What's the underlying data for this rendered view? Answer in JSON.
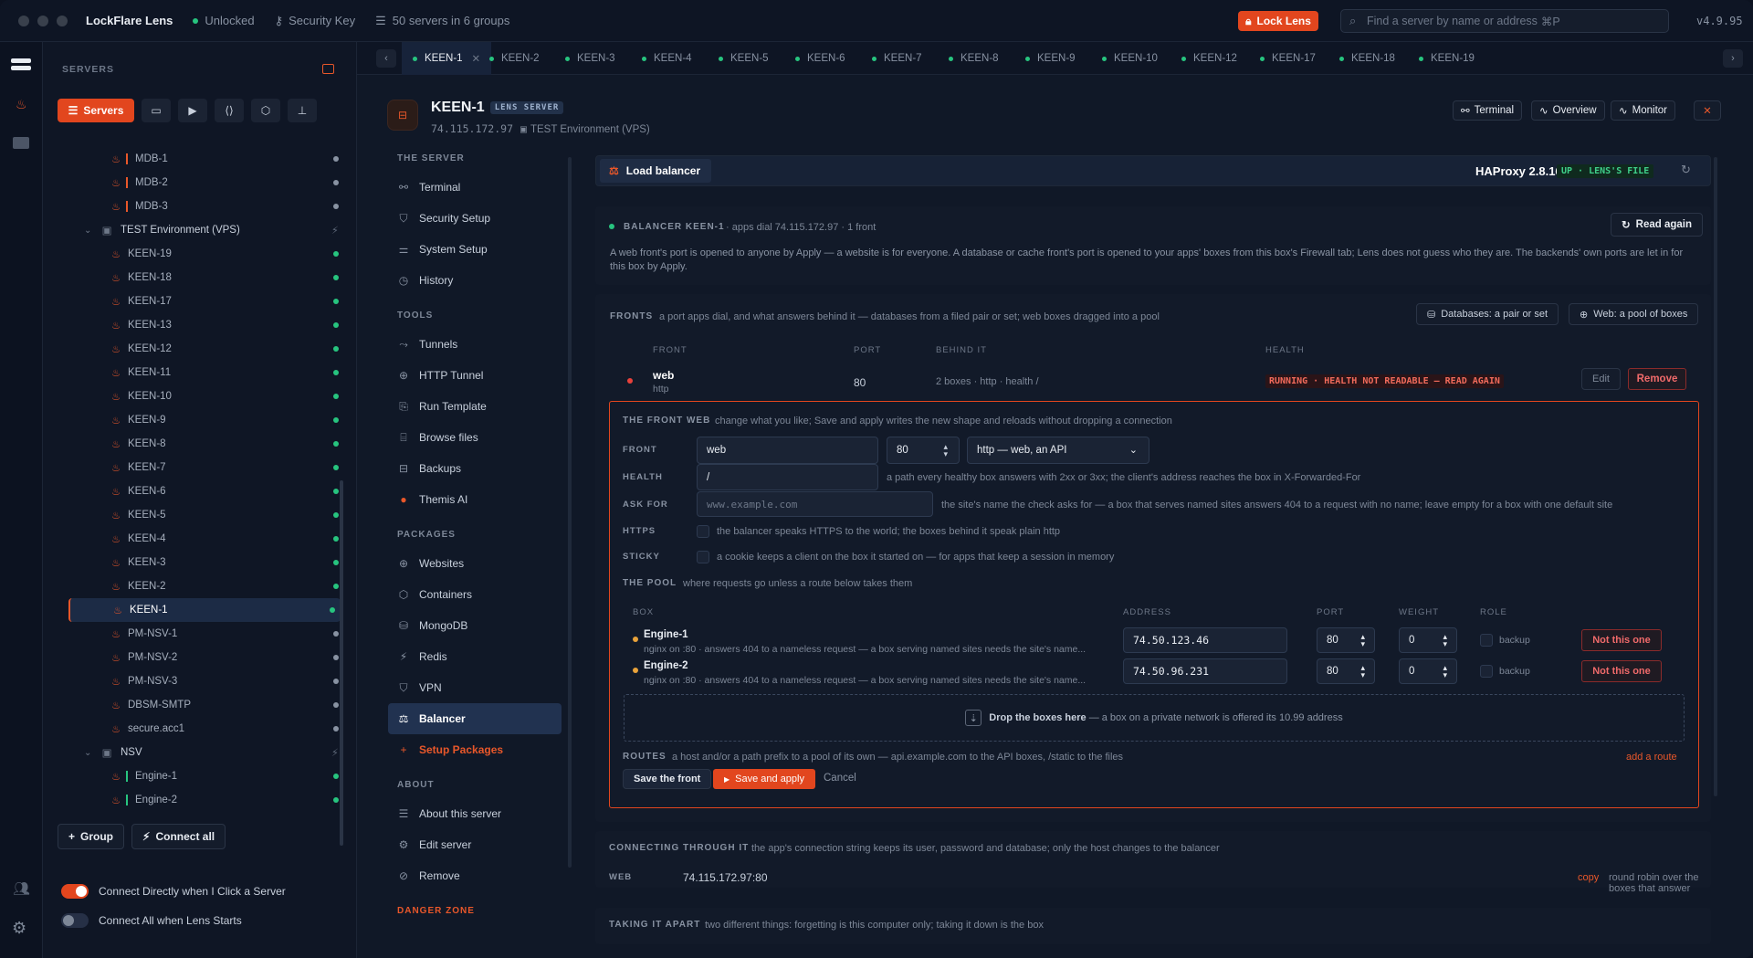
{
  "app": {
    "name": "LockFlare Lens",
    "status": "Unlocked",
    "security_key": "Security Key",
    "servers_summary": "50 servers in 6 groups",
    "lock_label": "Lock Lens",
    "search_placeholder": "Find a server by name or address",
    "search_shortcut": "⌘P",
    "version": "v4.9.95"
  },
  "sidebar": {
    "title": "SERVERS",
    "servers_btn": "Servers",
    "group_btn": "Group",
    "connect_all_btn": "Connect all",
    "toggle1_label": "Connect Directly when I Click a Server",
    "toggle2_label": "Connect All when Lens Starts",
    "tree": [
      {
        "kind": "server",
        "name": "MDB-1",
        "bar": "#e8572a",
        "status": "#8892a2"
      },
      {
        "kind": "server",
        "name": "MDB-2",
        "bar": "#e8572a",
        "status": "#8892a2"
      },
      {
        "kind": "server",
        "name": "MDB-3",
        "bar": "#e8572a",
        "status": "#8892a2"
      },
      {
        "kind": "group",
        "name": "TEST Environment (VPS)"
      },
      {
        "kind": "server",
        "name": "KEEN-19",
        "status": "#27c47f"
      },
      {
        "kind": "server",
        "name": "KEEN-18",
        "status": "#27c47f"
      },
      {
        "kind": "server",
        "name": "KEEN-17",
        "status": "#27c47f"
      },
      {
        "kind": "server",
        "name": "KEEN-13",
        "status": "#27c47f"
      },
      {
        "kind": "server",
        "name": "KEEN-12",
        "status": "#27c47f"
      },
      {
        "kind": "server",
        "name": "KEEN-11",
        "status": "#27c47f"
      },
      {
        "kind": "server",
        "name": "KEEN-10",
        "status": "#27c47f"
      },
      {
        "kind": "server",
        "name": "KEEN-9",
        "status": "#27c47f"
      },
      {
        "kind": "server",
        "name": "KEEN-8",
        "status": "#27c47f"
      },
      {
        "kind": "server",
        "name": "KEEN-7",
        "status": "#27c47f"
      },
      {
        "kind": "server",
        "name": "KEEN-6",
        "status": "#27c47f"
      },
      {
        "kind": "server",
        "name": "KEEN-5",
        "status": "#27c47f"
      },
      {
        "kind": "server",
        "name": "KEEN-4",
        "status": "#27c47f"
      },
      {
        "kind": "server",
        "name": "KEEN-3",
        "status": "#27c47f"
      },
      {
        "kind": "server",
        "name": "KEEN-2",
        "status": "#27c47f"
      },
      {
        "kind": "server",
        "name": "KEEN-1",
        "status": "#27c47f",
        "selected": true
      },
      {
        "kind": "server",
        "name": "PM-NSV-1",
        "status": "#8892a2"
      },
      {
        "kind": "server",
        "name": "PM-NSV-2",
        "status": "#8892a2"
      },
      {
        "kind": "server",
        "name": "PM-NSV-3",
        "status": "#8892a2"
      },
      {
        "kind": "server",
        "name": "DBSM-SMTP",
        "status": "#8892a2"
      },
      {
        "kind": "server",
        "name": "secure.acc1",
        "status": "#8892a2"
      },
      {
        "kind": "group",
        "name": "NSV"
      },
      {
        "kind": "server",
        "name": "Engine-1",
        "bar": "#27c47f",
        "status": "#27c47f"
      },
      {
        "kind": "server",
        "name": "Engine-2",
        "bar": "#27c47f",
        "status": "#27c47f"
      }
    ]
  },
  "tabs": [
    "KEEN-1",
    "KEEN-2",
    "KEEN-3",
    "KEEN-4",
    "KEEN-5",
    "KEEN-6",
    "KEEN-7",
    "KEEN-8",
    "KEEN-9",
    "KEEN-10",
    "KEEN-12",
    "KEEN-17",
    "KEEN-18",
    "KEEN-19"
  ],
  "header": {
    "title": "KEEN-1",
    "badge": "LENS SERVER",
    "ip": "74.115.172.97",
    "group": "TEST Environment (VPS)",
    "terminal": "Terminal",
    "overview": "Overview",
    "monitor": "Monitor"
  },
  "nav": {
    "server_title": "THE SERVER",
    "tools_title": "TOOLS",
    "packages_title": "PACKAGES",
    "about_title": "ABOUT",
    "danger": "DANGER ZONE",
    "server": [
      "Terminal",
      "Security Setup",
      "System Setup",
      "History"
    ],
    "tools": [
      "Tunnels",
      "HTTP Tunnel",
      "Run Template",
      "Browse files",
      "Backups",
      "Themis AI"
    ],
    "packages": [
      "Websites",
      "Containers",
      "MongoDB",
      "Redis",
      "VPN",
      "Balancer",
      "Setup Packages"
    ],
    "about": [
      "About this server",
      "Edit server",
      "Remove"
    ]
  },
  "panel": {
    "title": "Load balancer",
    "haproxy": "HAProxy 2.8.16",
    "haproxy_badge": "UP · LENS'S FILE",
    "balancer_name": "BALANCER KEEN-1",
    "balancer_meta": "· apps dial 74.115.172.97 · 1 front",
    "read_again": "Read again",
    "intro": "A web front's port is opened to anyone by Apply — a website is for everyone. A database or cache front's port is opened to your apps' boxes from this box's Firewall tab; Lens does not guess who they are. The backends' own ports are let in for this box by Apply.",
    "fronts_label": "FRONTS",
    "fronts_desc": "a port apps dial, and what answers behind it — databases from a filed pair or set; web boxes dragged into a pool",
    "db_btn": "Databases: a pair or set",
    "web_btn": "Web: a pool of boxes",
    "cols": [
      "FRONT",
      "PORT",
      "BEHIND IT",
      "HEALTH"
    ],
    "front": {
      "name": "web",
      "type": "http",
      "port": "80",
      "behind": "2 boxes · http · health /",
      "health": "RUNNING · HEALTH NOT READABLE — READ AGAIN",
      "edit": "Edit",
      "remove": "Remove"
    },
    "editor": {
      "title": "THE FRONT WEB",
      "title_desc": "change what you like; Save and apply writes the new shape and reloads without dropping a connection",
      "front_lbl": "FRONT",
      "front_val": "web",
      "port_val": "80",
      "mode_val": "http — web, an API",
      "health_lbl": "HEALTH",
      "health_val": "/",
      "health_desc": "a path every healthy box answers with 2xx or 3xx; the client's address reaches the box in X-Forwarded-For",
      "ask_lbl": "ASK FOR",
      "ask_placeholder": "www.example.com",
      "ask_desc": "the site's name the check asks for — a box that serves named sites answers 404 to a request with no name; leave empty for a box with one default site",
      "https_lbl": "HTTPS",
      "https_desc": "the balancer speaks HTTPS to the world; the boxes behind it speak plain http",
      "sticky_lbl": "STICKY",
      "sticky_desc": "a cookie keeps a client on the box it started on — for apps that keep a session in memory",
      "pool_lbl": "THE POOL",
      "pool_desc": "where requests go unless a route below takes them",
      "pool_cols": [
        "BOX",
        "ADDRESS",
        "PORT",
        "WEIGHT",
        "ROLE"
      ],
      "boxes": [
        {
          "name": "Engine-1",
          "desc": "nginx on :80 · answers 404 to a nameless request — a box serving named sites needs the site's name...",
          "address": "74.50.123.46",
          "port": "80",
          "weight": "0",
          "role": "backup",
          "action": "Not this one"
        },
        {
          "name": "Engine-2",
          "desc": "nginx on :80 · answers 404 to a nameless request — a box serving named sites needs the site's name...",
          "address": "74.50.96.231",
          "port": "80",
          "weight": "0",
          "role": "backup",
          "action": "Not this one"
        }
      ],
      "drop_bold": "Drop the boxes here",
      "drop_rest": " — a box on a private network is offered its 10.99 address",
      "routes_lbl": "ROUTES",
      "routes_desc": "a host and/or a path prefix to a pool of its own — api.example.com to the API boxes, /static to the files",
      "add_route": "add a route",
      "save": "Save the front",
      "apply": "Save and apply",
      "cancel": "Cancel"
    },
    "connecting_lbl": "CONNECTING THROUGH IT",
    "connecting_desc": "the app's connection string keeps its user, password and database; only the host changes to the balancer",
    "web_lbl": "WEB",
    "web_addr": "74.115.172.97:80",
    "copy": "copy",
    "web_note": "round robin over the boxes that answer",
    "apart_lbl": "TAKING IT APART",
    "apart_desc": "two different things: forgetting is this computer only; taking it down is the box"
  }
}
